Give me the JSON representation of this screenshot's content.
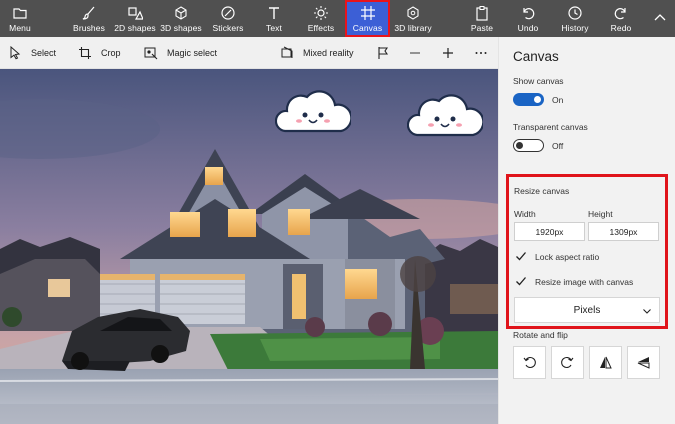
{
  "topbar": {
    "menu": "Menu",
    "brushes": "Brushes",
    "shapes2d": "2D shapes",
    "shapes3d": "3D shapes",
    "stickers": "Stickers",
    "text": "Text",
    "effects": "Effects",
    "canvas": "Canvas",
    "library3d": "3D library",
    "paste": "Paste",
    "undo": "Undo",
    "history": "History",
    "redo": "Redo",
    "active_tab": "Canvas"
  },
  "toolbar2": {
    "select": "Select",
    "crop": "Crop",
    "magic_select": "Magic select",
    "mixed_reality": "Mixed reality"
  },
  "panel": {
    "title": "Canvas",
    "show_canvas_label": "Show canvas",
    "show_canvas_state": "On",
    "transparent_label": "Transparent canvas",
    "transparent_state": "Off",
    "resize_label": "Resize canvas",
    "width_label": "Width",
    "height_label": "Height",
    "width_value": "1920px",
    "height_value": "1309px",
    "lock_aspect_label": "Lock aspect ratio",
    "lock_aspect_checked": true,
    "resize_image_label": "Resize image with canvas",
    "resize_image_checked": true,
    "units": "Pixels",
    "rotate_flip_label": "Rotate and flip"
  },
  "colors": {
    "toolbar_bg": "#505050",
    "active_tab_bg": "#3c5fd6",
    "highlight_red": "#e0141b",
    "accent_blue": "#1a64c4",
    "panel_bg": "#f2f2f2"
  },
  "icons": {
    "menu": "folder-icon",
    "brushes": "brush-icon",
    "shapes2d": "2d-shapes-icon",
    "shapes3d": "3d-cube-icon",
    "stickers": "sticker-icon",
    "text": "text-t-icon",
    "effects": "sun-effects-icon",
    "canvas": "canvas-grid-icon",
    "library3d": "3d-library-icon",
    "paste": "clipboard-icon",
    "undo": "undo-arrow-icon",
    "history": "clock-history-icon",
    "redo": "redo-arrow-icon"
  },
  "canvas_content": {
    "stickers": [
      "smiling-cloud",
      "smiling-cloud"
    ],
    "model_3d": "black-car",
    "background": "two-story-house-at-dusk"
  }
}
